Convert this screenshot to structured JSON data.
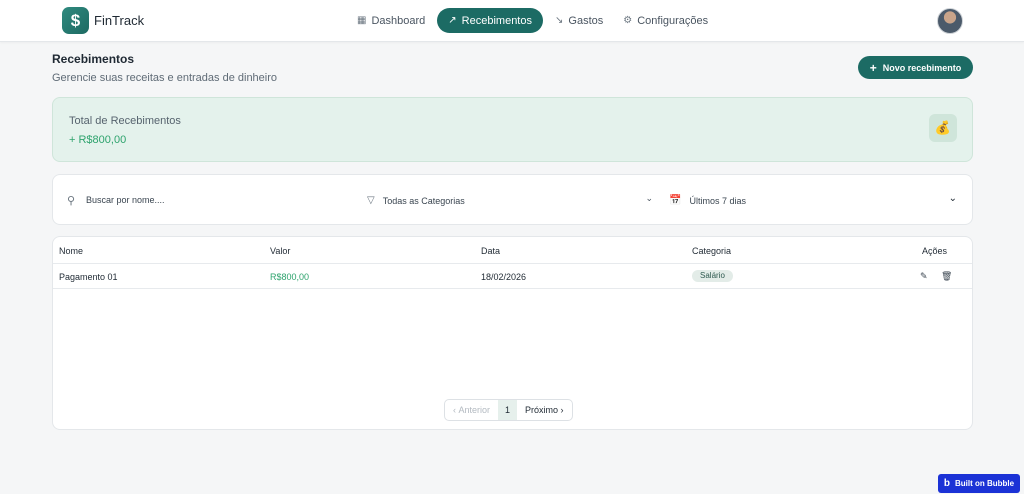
{
  "app": {
    "brand": "FinTrack",
    "logo_glyph": "$"
  },
  "nav": {
    "items": [
      {
        "label": "Dashboard",
        "icon": "grid-icon",
        "glyph": "▦",
        "active": false
      },
      {
        "label": "Recebimentos",
        "icon": "trending-up-icon",
        "glyph": "↗",
        "active": true
      },
      {
        "label": "Gastos",
        "icon": "trending-down-icon",
        "glyph": "↘",
        "active": false
      },
      {
        "label": "Configurações",
        "icon": "gear-icon",
        "glyph": "⚙",
        "active": false
      }
    ]
  },
  "page": {
    "title": "Recebimentos",
    "subtitle": "Gerencie suas receitas e entradas de dinheiro",
    "new_button": "Novo recebimento"
  },
  "summary": {
    "label": "Total de Recebimentos",
    "value": "+ R$800,00",
    "icon": "money-bag-icon"
  },
  "filters": {
    "search_placeholder": "Buscar por nome....",
    "category": "Todas as Categorias",
    "period": "Últimos 7 dias"
  },
  "table": {
    "columns": [
      "Nome",
      "Valor",
      "Data",
      "Categoria",
      "Ações"
    ],
    "rows": [
      {
        "nome": "Pagamento 01",
        "valor": "R$800,00",
        "data": "18/02/2026",
        "categoria": "Salário"
      }
    ]
  },
  "pagination": {
    "prev": "Anterior",
    "current": "1",
    "next": "Próximo"
  },
  "footer": {
    "badge": "Built on Bubble"
  },
  "colors": {
    "primary": "#1c6b64",
    "positive": "#2ea36d",
    "summary_bg": "#e4f2ec",
    "bubble": "#1b32d6"
  }
}
